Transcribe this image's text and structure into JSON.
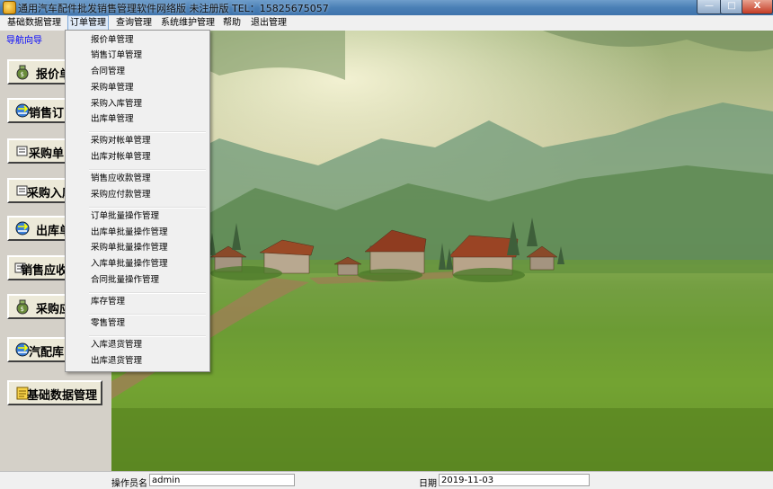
{
  "window": {
    "title": "通用汽车配件批发销售管理软件网络版 未注册版 TEL：15825675057",
    "minimize_glyph": "—",
    "maximize_glyph": "□",
    "close_glyph": "X"
  },
  "menubar": {
    "items": [
      "基础数据管理",
      "订单管理",
      "查询管理",
      "系统维护管理",
      "帮助",
      "退出管理"
    ],
    "active": "订单管理"
  },
  "nav": {
    "title": "导航向导",
    "buttons": [
      {
        "label": "报价单",
        "icon": "moneybag-icon"
      },
      {
        "label": "销售订",
        "icon": "transfer-icon"
      },
      {
        "label": "采购单",
        "icon": "document-icon"
      },
      {
        "label": "采购入库",
        "icon": "document-icon"
      },
      {
        "label": "出库单",
        "icon": "transfer-icon"
      },
      {
        "label": "销售应收",
        "icon": "document-icon"
      },
      {
        "label": "采购应",
        "icon": "moneybag-icon"
      },
      {
        "label": "汽配库",
        "icon": "transfer-icon"
      },
      {
        "label": "基础数据管理",
        "icon": "notepad-icon"
      }
    ]
  },
  "dropdown": {
    "groups": [
      [
        "报价单管理",
        "销售订单管理",
        "合同管理",
        "采购单管理",
        "采购入库管理",
        "出库单管理"
      ],
      [
        "采购对帐单管理",
        "出库对帐单管理"
      ],
      [
        "销售应收款管理",
        "采购应付款管理"
      ],
      [
        "订单批量操作管理",
        "出库单批量操作管理",
        "采购单批量操作管理",
        "入库单批量操作管理",
        "合同批量操作管理"
      ],
      [
        "库存管理"
      ],
      [
        "零售管理"
      ],
      [
        "入库退货管理",
        "出库退货管理"
      ]
    ]
  },
  "statusbar": {
    "operator_label": "操作员名",
    "operator_value": "admin",
    "date_label": "日期",
    "date_value": "2019-11-03"
  },
  "colors": {
    "title_bar": "#4a7fb5",
    "nav_link": "#0000ff",
    "close_button": "#c43b24"
  }
}
